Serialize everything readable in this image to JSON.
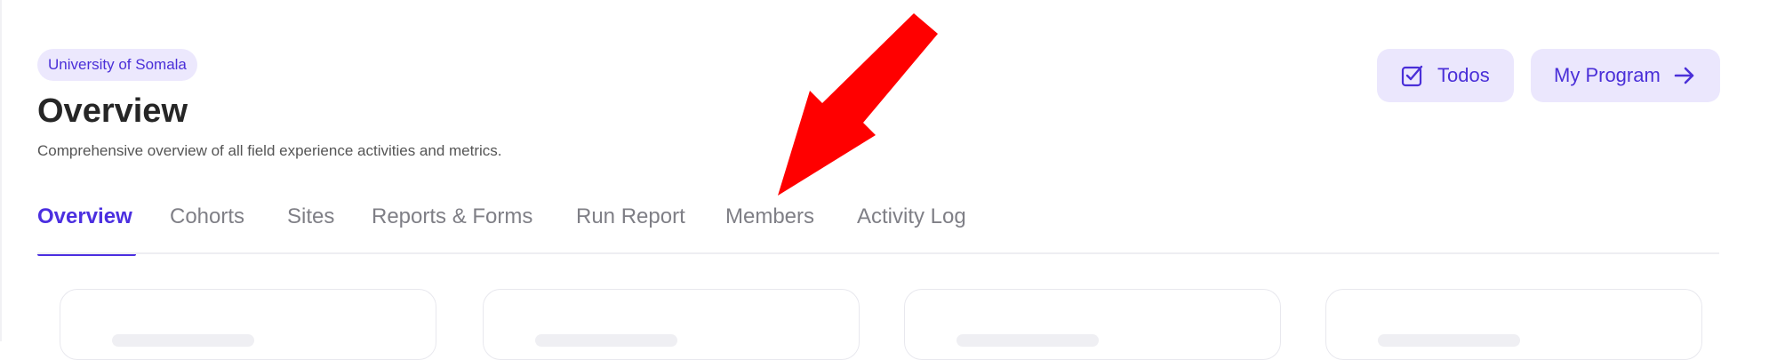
{
  "header": {
    "org_badge": "University of Somala",
    "title": "Overview",
    "subtitle": "Comprehensive overview of all field experience activities and metrics."
  },
  "actions": {
    "todos_label": "Todos",
    "todos_icon": "checkbox-icon",
    "program_label": "My Program",
    "program_icon": "arrow-right-icon"
  },
  "tabs": [
    {
      "label": "Overview",
      "active": true
    },
    {
      "label": "Cohorts",
      "active": false
    },
    {
      "label": "Sites",
      "active": false
    },
    {
      "label": "Reports & Forms",
      "active": false
    },
    {
      "label": "Run Report",
      "active": false
    },
    {
      "label": "Members",
      "active": false
    },
    {
      "label": "Activity Log",
      "active": false
    }
  ],
  "colors": {
    "accent": "#4b2fe0",
    "badge_bg": "#ece8fd",
    "annotation_arrow": "#ff0000"
  }
}
